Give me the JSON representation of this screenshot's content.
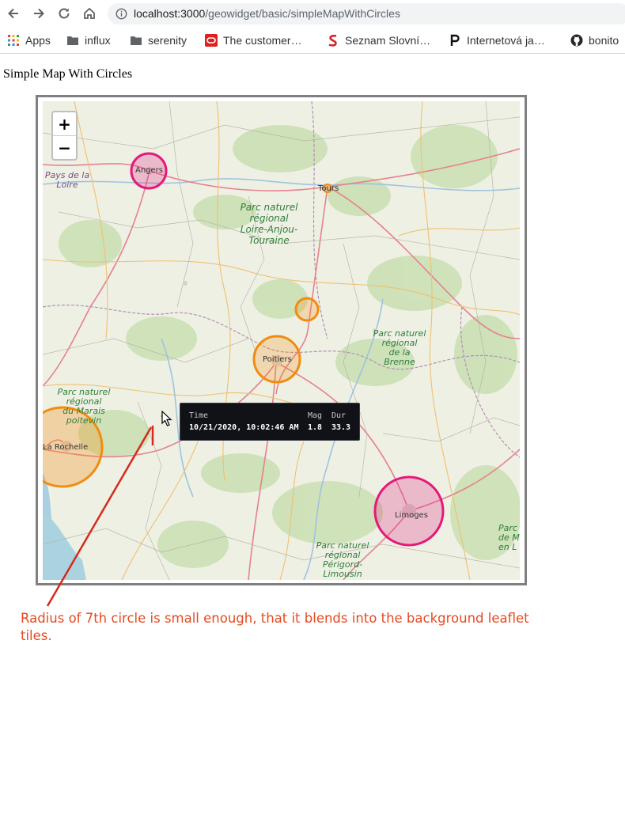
{
  "browser": {
    "url_host": "localhost:3000",
    "url_path": "/geowidget/basic/simpleMapWithCircles",
    "bookmarks": [
      {
        "label": "Apps",
        "icon": "apps-grid-icon"
      },
      {
        "label": "influx",
        "icon": "folder-icon"
      },
      {
        "label": "serenity",
        "icon": "folder-icon"
      },
      {
        "label": "The customer…",
        "icon": "oracle-icon"
      },
      {
        "label": "Seznam Slovní…",
        "icon": "seznam-icon"
      },
      {
        "label": "Internetová ja…",
        "icon": "p-letter-icon"
      },
      {
        "label": "bonito",
        "icon": "github-icon"
      }
    ]
  },
  "page": {
    "title": "Simple Map With Circles"
  },
  "map": {
    "zoom_in_label": "+",
    "zoom_out_label": "−",
    "places": {
      "angers": "Angers",
      "tours": "Tours",
      "poitiers": "Poitiers",
      "la_rochelle": "La Rochelle",
      "limoges": "Limoges"
    },
    "regions": {
      "pays_de_la_loire": [
        "Pays de la",
        "Loire"
      ],
      "loire_anjou": [
        "Parc naturel",
        "régional",
        "Loire-Anjou-",
        "Touraine"
      ],
      "brenne": [
        "Parc naturel",
        "régional",
        "de la Brenne"
      ],
      "marais": [
        "Parc naturel",
        "régional",
        "du Marais",
        "poitevin"
      ],
      "perigord": [
        "Parc naturel",
        "régional",
        "Périgord-",
        "Limousin"
      ],
      "edge": [
        "Parc",
        "de Mi",
        "en L"
      ]
    },
    "colors": {
      "pink": "#e5197a",
      "orange": "#f28c0f"
    },
    "tooltip": {
      "time_header": "Time",
      "mag_header": "Mag",
      "dur_header": "Dur",
      "time_value": "10/21/2020, 10:02:46 AM",
      "mag_value": "1.8",
      "dur_value": "33.3"
    }
  },
  "annotation": {
    "text": "Radius of 7th circle is small enough, that it blends into the background leaflet tiles.",
    "color": "#e8491f"
  }
}
